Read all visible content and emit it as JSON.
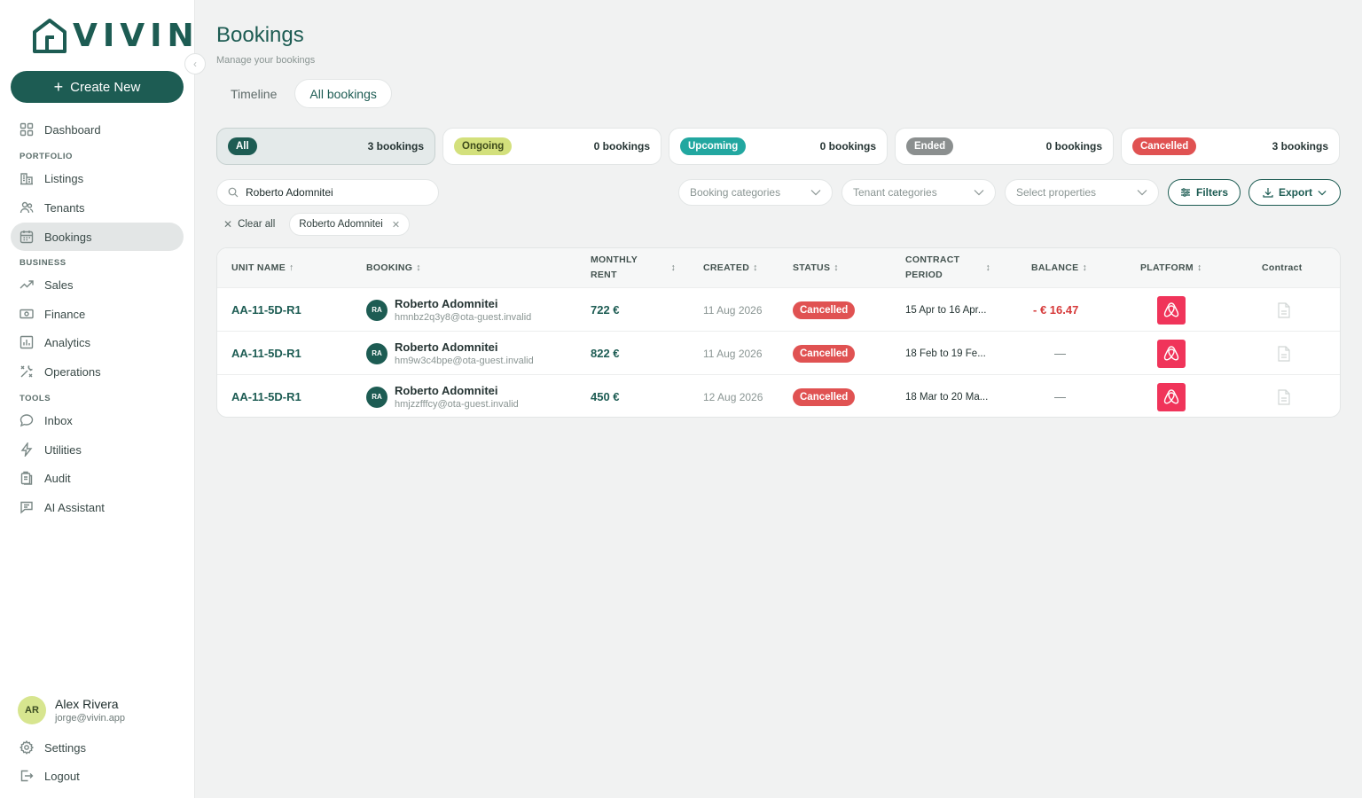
{
  "brand": {
    "logo_text": "VIVIN"
  },
  "sidebar": {
    "create_label": "Create New",
    "dashboard": "Dashboard",
    "sections": {
      "portfolio": "PORTFOLIO",
      "business": "BUSINESS",
      "tools": "TOOLS"
    },
    "items": {
      "listings": "Listings",
      "tenants": "Tenants",
      "bookings": "Bookings",
      "sales": "Sales",
      "finance": "Finance",
      "analytics": "Analytics",
      "operations": "Operations",
      "inbox": "Inbox",
      "utilities": "Utilities",
      "audit": "Audit",
      "ai_assistant": "AI Assistant"
    },
    "user": {
      "initials": "AR",
      "name": "Alex Rivera",
      "email": "jorge@vivin.app"
    },
    "settings": "Settings",
    "logout": "Logout"
  },
  "page": {
    "title": "Bookings",
    "subtitle": "Manage your bookings"
  },
  "tabs": {
    "timeline": "Timeline",
    "all": "All bookings"
  },
  "status_cards": [
    {
      "label": "All",
      "count": "3 bookings",
      "bg": "#1d5c53",
      "fg": "#ffffff"
    },
    {
      "label": "Ongoing",
      "count": "0 bookings",
      "bg": "#d3e07c",
      "fg": "#3d4a1a"
    },
    {
      "label": "Upcoming",
      "count": "0 bookings",
      "bg": "#22a7a0",
      "fg": "#ffffff"
    },
    {
      "label": "Ended",
      "count": "0 bookings",
      "bg": "#8b8f8f",
      "fg": "#ffffff"
    },
    {
      "label": "Cancelled",
      "count": "3 bookings",
      "bg": "#e05252",
      "fg": "#ffffff"
    }
  ],
  "filters": {
    "search_value": "Roberto Adomnitei",
    "booking_categories": "Booking categories",
    "tenant_categories": "Tenant categories",
    "select_properties": "Select properties",
    "filters_label": "Filters",
    "export_label": "Export",
    "clear_all": "Clear all",
    "chip": "Roberto Adomnitei"
  },
  "table": {
    "headers": {
      "unit": "UNIT NAME",
      "booking": "BOOKING",
      "rent_line1": "MONTHLY",
      "rent_line2": "RENT",
      "created": "CREATED",
      "status": "STATUS",
      "period_line1": "CONTRACT",
      "period_line2": "PERIOD",
      "balance": "BALANCE",
      "platform": "PLATFORM",
      "contract": "Contract"
    },
    "rows": [
      {
        "unit": "AA-11-5D-R1",
        "initials": "RA",
        "name": "Roberto Adomnitei",
        "email": "hmnbz2q3y8@ota-guest.invalid",
        "rent": "722 €",
        "created": "11 Aug 2026",
        "status": "Cancelled",
        "period": "15 Apr to 16 Apr...",
        "balance": "- € 16.47"
      },
      {
        "unit": "AA-11-5D-R1",
        "initials": "RA",
        "name": "Roberto Adomnitei",
        "email": "hm9w3c4bpe@ota-guest.invalid",
        "rent": "822 €",
        "created": "11 Aug 2026",
        "status": "Cancelled",
        "period": "18 Feb to 19 Fe...",
        "balance": "—"
      },
      {
        "unit": "AA-11-5D-R1",
        "initials": "RA",
        "name": "Roberto Adomnitei",
        "email": "hmjzzfffcy@ota-guest.invalid",
        "rent": "450 €",
        "created": "12 Aug 2026",
        "status": "Cancelled",
        "period": "18 Mar to 20 Ma...",
        "balance": "—"
      }
    ]
  }
}
